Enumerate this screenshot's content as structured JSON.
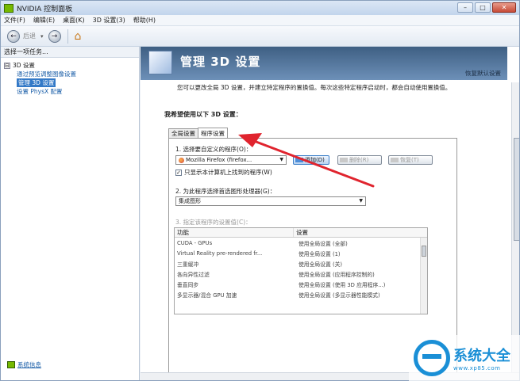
{
  "window": {
    "title": "NVIDIA 控制面板",
    "controls": {
      "minimize": "–",
      "maximize": "□",
      "close": "✕"
    }
  },
  "menubar": [
    "文件(F)",
    "编辑(E)",
    "桌面(K)",
    "3D 设置(3)",
    "帮助(H)"
  ],
  "toolbar": {
    "back_label": "后退",
    "back_dropdown": "▾",
    "forward": "→",
    "back": "←"
  },
  "sidebar": {
    "header": "选择一项任务...",
    "tree": {
      "root_toggle": "⊟",
      "root": "3D 设置",
      "items": [
        {
          "label": "通过预览调整图像设置",
          "selected": false
        },
        {
          "label": "管理 3D 设置",
          "selected": true
        },
        {
          "label": "设置 PhysX 配置",
          "selected": false
        }
      ]
    },
    "footer_link": "系统信息"
  },
  "page": {
    "title": "管理 3D 设置",
    "restore_defaults": "恢复默认设置",
    "description": "您可以更改全局 3D 设置，并建立特定程序的置换值。每次这些特定程序启动时，都会自动使用置换值。",
    "section_header": "我希望使用以下 3D 设置：",
    "tabs": [
      {
        "label": "全局设置",
        "active": false
      },
      {
        "label": "程序设置",
        "active": true
      }
    ],
    "step1": {
      "label": "1. 选择要自定义的程序(O)：",
      "selected_program": "Mozilla Firefox (firefox...",
      "add_button": "添加(D)",
      "remove_button": "删除(R)",
      "restore_button": "恢复(T)",
      "checkbox_label": "只显示本计算机上找到的程序(W)",
      "checkbox_checked": true
    },
    "step2": {
      "label": "2. 为此程序选择首选图形处理器(G)：",
      "selected": "集成图形"
    },
    "step3": {
      "label": "3. 指定该程序的设置值(C)：",
      "columns": [
        "功能",
        "设置"
      ],
      "rows": [
        {
          "feature": "CUDA - GPUs",
          "setting": "使用全局设置 (全部)"
        },
        {
          "feature": "Virtual Reality pre-rendered fr...",
          "setting": "使用全局设置 (1)"
        },
        {
          "feature": "三重缓冲",
          "setting": "使用全局设置 (关)"
        },
        {
          "feature": "各向异性过滤",
          "setting": "使用全局设置 (应用程序控制的)"
        },
        {
          "feature": "垂直同步",
          "setting": "使用全局设置 (使用 3D 应用程序...)"
        },
        {
          "feature": "多显示器/混合 GPU 加速",
          "setting": "使用全局设置 (多显示器性能模式)"
        }
      ]
    }
  },
  "watermark": {
    "title": "系统大全",
    "url": "www.xp85.com"
  },
  "colors": {
    "accent": "#3379c7",
    "arrow": "#e0242e",
    "watermark": "#1a8fd6",
    "nvidia": "#76b900"
  }
}
